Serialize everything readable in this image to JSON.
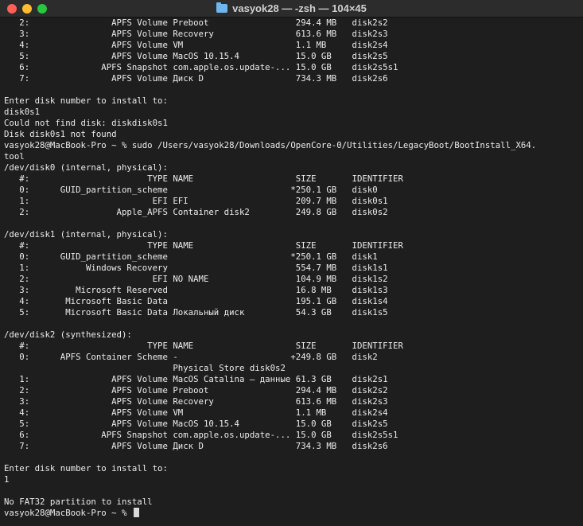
{
  "window": {
    "title": "vasyok28 — -zsh — 104×45",
    "folder_icon": "folder-icon"
  },
  "terminal": {
    "lines": [
      "   2:                APFS Volume Preboot                 294.4 MB   disk2s2",
      "   3:                APFS Volume Recovery                613.6 MB   disk2s3",
      "   4:                APFS Volume VM                      1.1 MB     disk2s4",
      "   5:                APFS Volume MacOS 10.15.4           15.0 GB    disk2s5",
      "   6:              APFS Snapshot com.apple.os.update-... 15.0 GB    disk2s5s1",
      "   7:                APFS Volume Диск D                  734.3 MB   disk2s6",
      "",
      "Enter disk number to install to:",
      "disk0s1",
      "Could not find disk: diskdisk0s1",
      "Disk disk0s1 not found",
      "vasyok28@MacBook-Pro ~ % sudo /Users/vasyok28/Downloads/OpenCore-0/Utilities/LegacyBoot/BootInstall_X64.",
      "tool",
      "/dev/disk0 (internal, physical):",
      "   #:                       TYPE NAME                    SIZE       IDENTIFIER",
      "   0:      GUID_partition_scheme                        *250.1 GB   disk0",
      "   1:                        EFI EFI                     209.7 MB   disk0s1",
      "   2:                 Apple_APFS Container disk2         249.8 GB   disk0s2",
      "",
      "/dev/disk1 (internal, physical):",
      "   #:                       TYPE NAME                    SIZE       IDENTIFIER",
      "   0:      GUID_partition_scheme                        *250.1 GB   disk1",
      "   1:           Windows Recovery                         554.7 MB   disk1s1",
      "   2:                        EFI NO NAME                 104.9 MB   disk1s2",
      "   3:         Microsoft Reserved                         16.8 MB    disk1s3",
      "   4:       Microsoft Basic Data                         195.1 GB   disk1s4",
      "   5:       Microsoft Basic Data Локальный диск          54.3 GB    disk1s5",
      "",
      "/dev/disk2 (synthesized):",
      "   #:                       TYPE NAME                    SIZE       IDENTIFIER",
      "   0:      APFS Container Scheme -                      +249.8 GB   disk2",
      "                                 Physical Store disk0s2",
      "   1:                APFS Volume MacOS Catalina — данные 61.3 GB    disk2s1",
      "   2:                APFS Volume Preboot                 294.4 MB   disk2s2",
      "   3:                APFS Volume Recovery                613.6 MB   disk2s3",
      "   4:                APFS Volume VM                      1.1 MB     disk2s4",
      "   5:                APFS Volume MacOS 10.15.4           15.0 GB    disk2s5",
      "   6:              APFS Snapshot com.apple.os.update-... 15.0 GB    disk2s5s1",
      "   7:                APFS Volume Диск D                  734.3 MB   disk2s6",
      "",
      "Enter disk number to install to:",
      "1",
      "",
      "No FAT32 partition to install"
    ],
    "prompt": "vasyok28@MacBook-Pro ~ % "
  },
  "colors": {
    "background": "#1e1e1e",
    "text": "#ececec",
    "close": "#fe5f57",
    "minimize": "#febc2e",
    "maximize": "#28c840"
  }
}
